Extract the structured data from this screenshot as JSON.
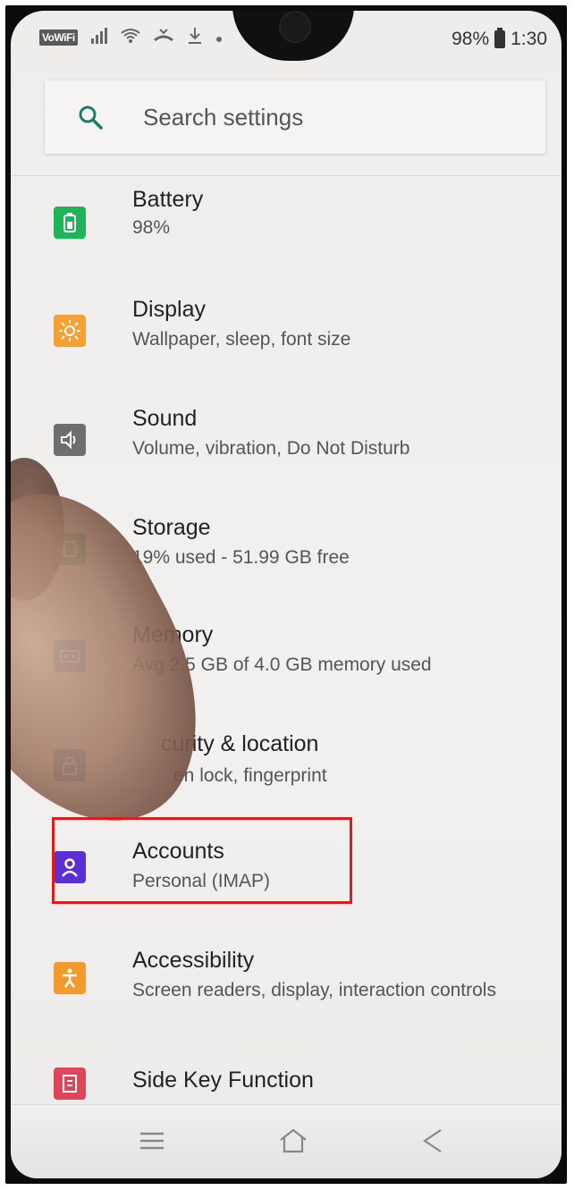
{
  "status_bar": {
    "vowifi": "VoWiFi",
    "battery_percent": "98%",
    "time": "1:30"
  },
  "search": {
    "placeholder": "Search settings"
  },
  "items": [
    {
      "title": "Battery",
      "subtitle": "98%",
      "icon": "battery-icon",
      "color": "#1fb45a"
    },
    {
      "title": "Display",
      "subtitle": "Wallpaper, sleep, font size",
      "icon": "brightness-icon",
      "color": "#f5a033"
    },
    {
      "title": "Sound",
      "subtitle": "Volume, vibration, Do Not Disturb",
      "icon": "speaker-icon",
      "color": "#6e6e6e"
    },
    {
      "title": "Storage",
      "subtitle": "19% used - 51.99 GB free",
      "icon": "storage-chip-icon",
      "color": "#23b04e"
    },
    {
      "title": "Memory",
      "subtitle": "Avg 2.5 GB of 4.0 GB memory used",
      "icon": "memory-icon",
      "color": "#3a87d9"
    },
    {
      "title": "curity & location",
      "subtitle": "en lock, fingerprint",
      "icon": "lock-icon",
      "color": "#2f6fd0"
    },
    {
      "title": "Accounts",
      "subtitle": "Personal (IMAP)",
      "icon": "account-icon",
      "color": "#5a2fd6"
    },
    {
      "title": "Accessibility",
      "subtitle": "Screen readers, display, interaction controls",
      "icon": "accessibility-icon",
      "color": "#f29a2b"
    },
    {
      "title": "Side Key Function",
      "subtitle": "",
      "icon": "side-key-icon",
      "color": "#e0465a"
    }
  ]
}
